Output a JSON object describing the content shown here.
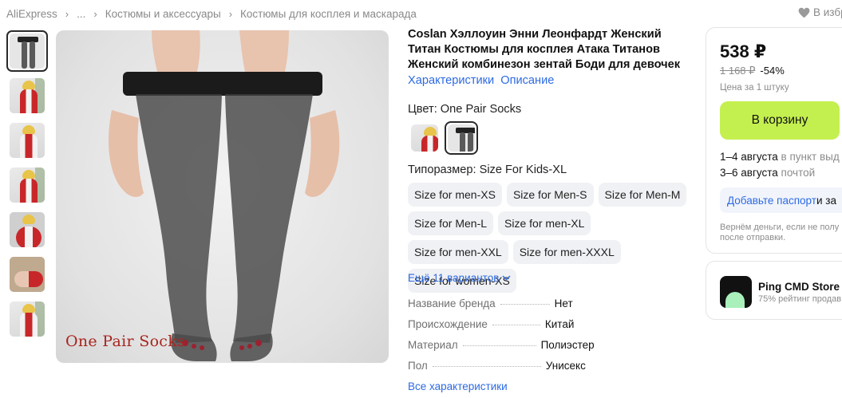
{
  "breadcrumb": {
    "items": [
      "AliExpress",
      "...",
      "Костюмы и аксессуары",
      "Костюмы для косплея и маскарада"
    ],
    "favorites_label": "В избр"
  },
  "gallery": {
    "thumbnail_count": 7,
    "active_index": 0,
    "main_image_caption": "One Pair Socks"
  },
  "product": {
    "title": "Coslan Хэллоуин Энни Леонфардт Женский Титан Костюмы для косплея Атака Титанов Женский комбинезон зентай Боди для девочек",
    "tabs": [
      "Характеристики",
      "Описание"
    ],
    "color_label": "Цвет: One Pair Socks",
    "size_label": "Типоразмер: Size For Kids-XL",
    "sizes": [
      "Size for men-XS",
      "Size for Men-S",
      "Size for Men-M",
      "Size for Men-L",
      "Size for men-XL",
      "Size for men-XXL",
      "Size for men-XXXL",
      "Size for women-XS"
    ],
    "more_variants": "Ещё 11 вариантов",
    "specs": [
      {
        "name": "Название бренда",
        "value": "Нет"
      },
      {
        "name": "Происхождение",
        "value": "Китай"
      },
      {
        "name": "Материал",
        "value": "Полиэстер"
      },
      {
        "name": "Пол",
        "value": "Унисекс"
      }
    ],
    "all_specs": "Все характеристики"
  },
  "buybox": {
    "price": "538 ₽",
    "old_price": "1 168 ₽",
    "discount": "-54%",
    "per_unit": "Цена за 1 штуку",
    "cart_button": "В корзину",
    "delivery_1_date": "1–4 августа",
    "delivery_1_text": " в пункт выд",
    "delivery_2_date": "3–6 августа",
    "delivery_2_text": " почтой",
    "passport_link": "Добавьте паспорт",
    "passport_rest": " и за",
    "refund": "Вернём деньги, если не полу после отправки."
  },
  "store": {
    "name": "Ping CMD Store",
    "rating": "75% рейтинг продав"
  },
  "colors": {
    "accent_link": "#2d6ae3",
    "cart_button": "#c4f04f",
    "caption_red": "#a8261f"
  }
}
